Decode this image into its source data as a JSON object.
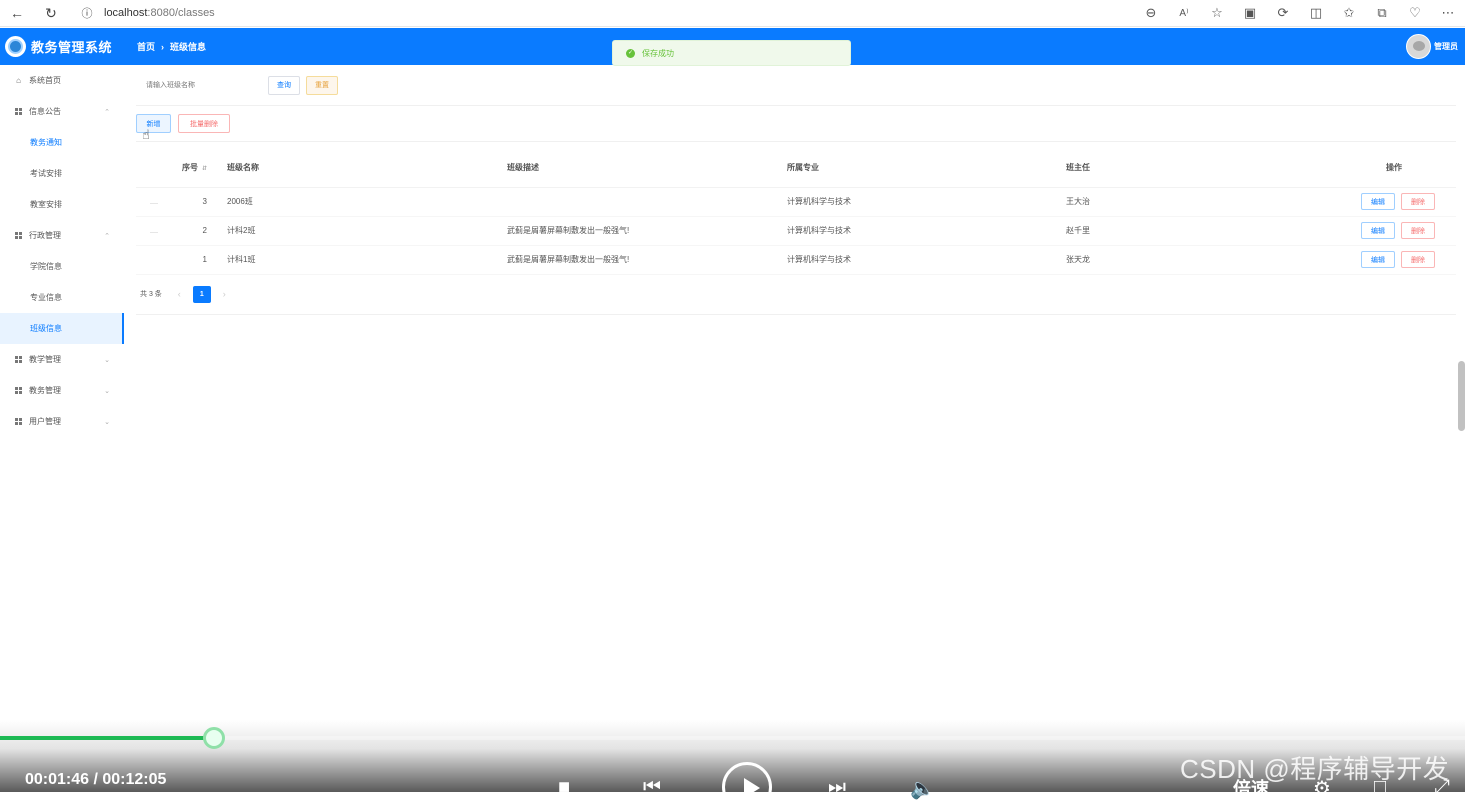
{
  "browser": {
    "url_host": "localhost",
    "url_path": ":8080/classes"
  },
  "header": {
    "app_title": "教务管理系统",
    "breadcrumb_home": "首页",
    "breadcrumb_current": "班级信息",
    "user_name": "管理员",
    "brand_color": "#0a7bff"
  },
  "toast": {
    "message": "保存成功",
    "color": "#67c23a"
  },
  "sidebar": {
    "items": [
      {
        "label": "系统首页",
        "icon": "home-icon"
      },
      {
        "label": "信息公告",
        "icon": "grid-icon",
        "expanded": true
      },
      {
        "label": "教务通知"
      },
      {
        "label": "考试安排"
      },
      {
        "label": "教室安排"
      },
      {
        "label": "行政管理",
        "icon": "grid-icon",
        "expanded": true
      },
      {
        "label": "学院信息"
      },
      {
        "label": "专业信息"
      },
      {
        "label": "班级信息",
        "selected": true
      },
      {
        "label": "教学管理",
        "icon": "grid-icon"
      },
      {
        "label": "教务管理",
        "icon": "grid-icon"
      },
      {
        "label": "用户管理",
        "icon": "grid-icon"
      }
    ]
  },
  "search": {
    "placeholder": "请输入班级名称",
    "query_label": "查询",
    "reset_label": "重置"
  },
  "actions": {
    "add_label": "新增",
    "batch_delete_label": "批量删除"
  },
  "table": {
    "headers": {
      "no": "序号",
      "name": "班级名称",
      "desc": "班级描述",
      "major": "所属专业",
      "teacher": "班主任",
      "op": "操作"
    },
    "rows": [
      {
        "no": "3",
        "name": "2006班",
        "desc": "",
        "major": "计算机科学与技术",
        "teacher": "王大治"
      },
      {
        "no": "2",
        "name": "计科2班",
        "desc": "武蓟是屑薯屏幕制敷发出一般强气!",
        "major": "计算机科学与技术",
        "teacher": "赵千里"
      },
      {
        "no": "1",
        "name": "计科1班",
        "desc": "武蓟是屑薯屏幕制敷发出一般强气!",
        "major": "计算机科学与技术",
        "teacher": "张天龙"
      }
    ],
    "edit_label": "编辑",
    "delete_label": "删除"
  },
  "pagination": {
    "total_text": "共 3 条",
    "current_page": "1"
  },
  "player": {
    "time": "00:01:46 / 00:12:05",
    "progress": 0.1462,
    "speed_label": "倍速",
    "watermark": "CSDN @程序辅导开发"
  }
}
